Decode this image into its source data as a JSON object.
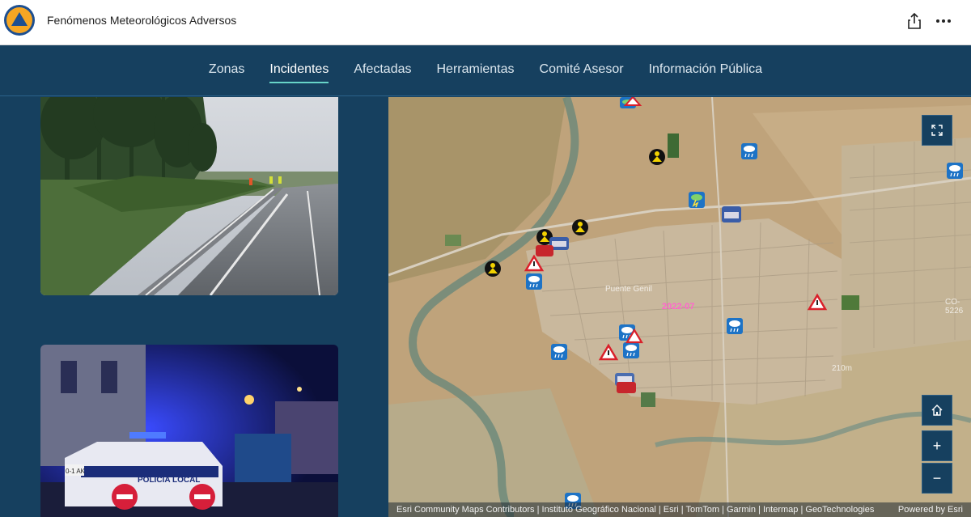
{
  "header": {
    "title": "Fenómenos Meteorológicos Adversos",
    "share_icon": "share-icon",
    "more_icon": "more-options-icon"
  },
  "nav": {
    "tabs": [
      {
        "label": "Zonas",
        "active": false
      },
      {
        "label": "Incidentes",
        "active": true
      },
      {
        "label": "Afectadas",
        "active": false
      },
      {
        "label": "Herramientas",
        "active": false
      },
      {
        "label": "Comité Asesor",
        "active": false
      },
      {
        "label": "Información Pública",
        "active": false
      }
    ]
  },
  "photos": {
    "photo2_text": {
      "vehicle": "POLICIA LOCAL",
      "plate": "0-1 AK"
    }
  },
  "map": {
    "labels": {
      "town": "Puente Genil",
      "date": "2022-07",
      "elevation": "210m",
      "road": "CO-5226"
    },
    "controls": {
      "fullscreen_icon": "expand-icon",
      "home_icon": "home-icon",
      "zoom_in": "+",
      "zoom_out": "−"
    },
    "attribution": "Esri Community Maps Contributors | Instituto Geográfico Nacional | Esri | TomTom | Garmin | Intermap | GeoTechnologies",
    "powered": "Powered by Esri"
  },
  "colors": {
    "brand": "#16405f",
    "accent": "#67d4c8",
    "logo_blue": "#1d4f91",
    "logo_orange": "#f6a623"
  }
}
